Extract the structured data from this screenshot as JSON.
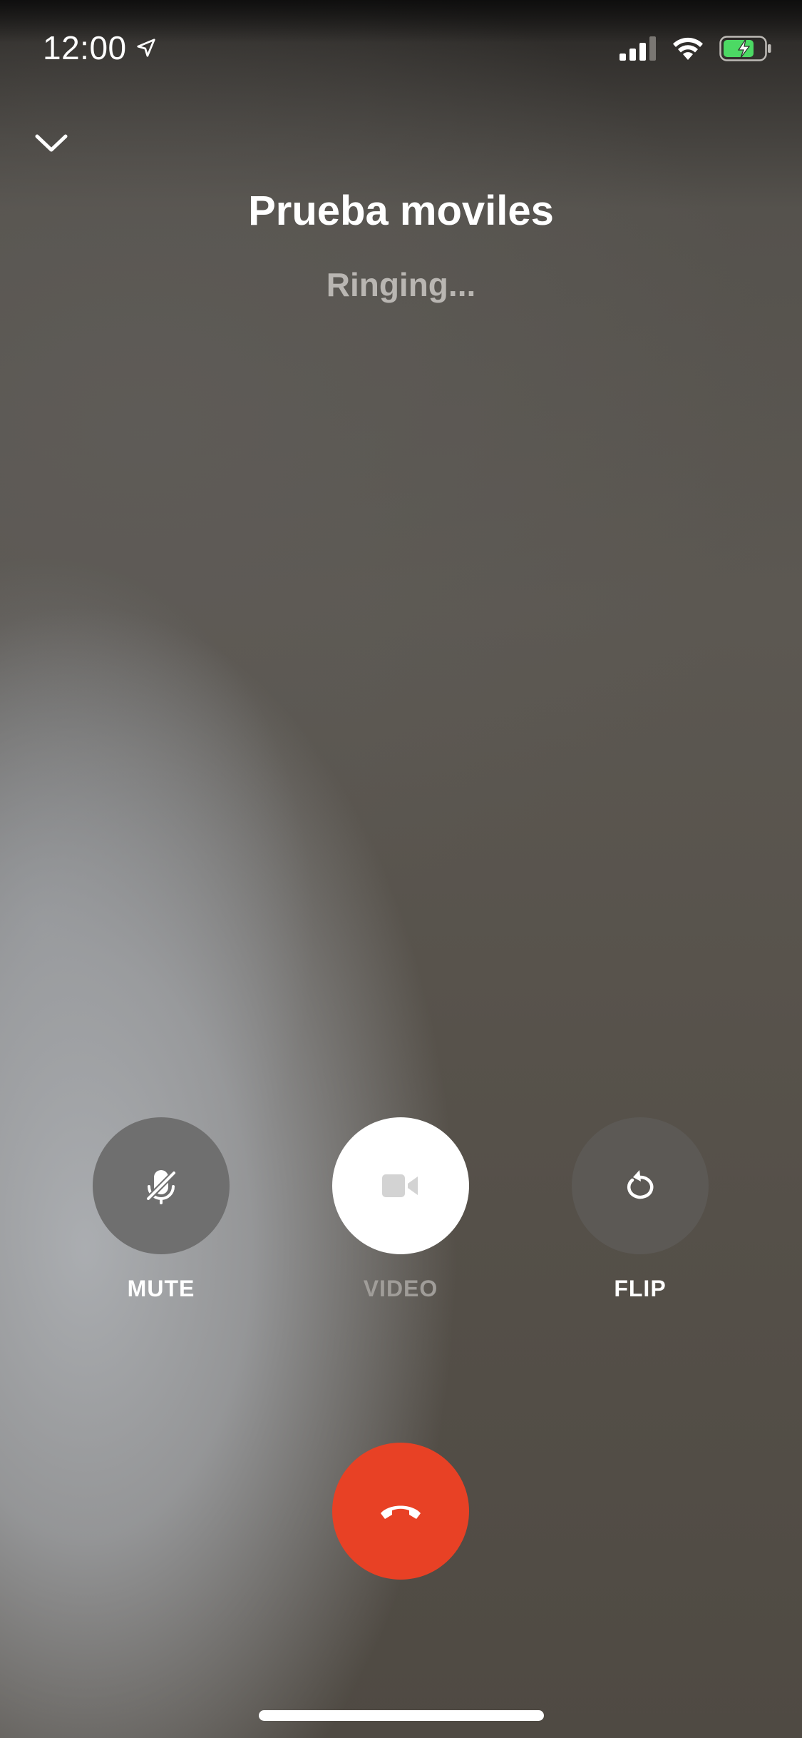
{
  "status_bar": {
    "time": "12:00",
    "icons": [
      "location-arrow-icon",
      "cellular-signal-icon",
      "wifi-icon",
      "battery-charging-icon"
    ],
    "battery_color": "#4cd964"
  },
  "header": {
    "collapse_icon": "chevron-down-icon",
    "contact_name": "Prueba moviles",
    "call_status": "Ringing..."
  },
  "controls": [
    {
      "id": "mute",
      "label": "MUTE",
      "icon": "mic-off-icon",
      "state": "active"
    },
    {
      "id": "video",
      "label": "VIDEO",
      "icon": "video-camera-icon",
      "state": "disabled"
    },
    {
      "id": "flip",
      "label": "FLIP",
      "icon": "camera-flip-icon",
      "state": "active"
    }
  ],
  "end_call": {
    "icon": "hang-up-icon",
    "color": "#e84125"
  },
  "colors": {
    "accent_end_call": "#e84125",
    "label_active": "#ffffff",
    "label_disabled": "#a09d99"
  }
}
